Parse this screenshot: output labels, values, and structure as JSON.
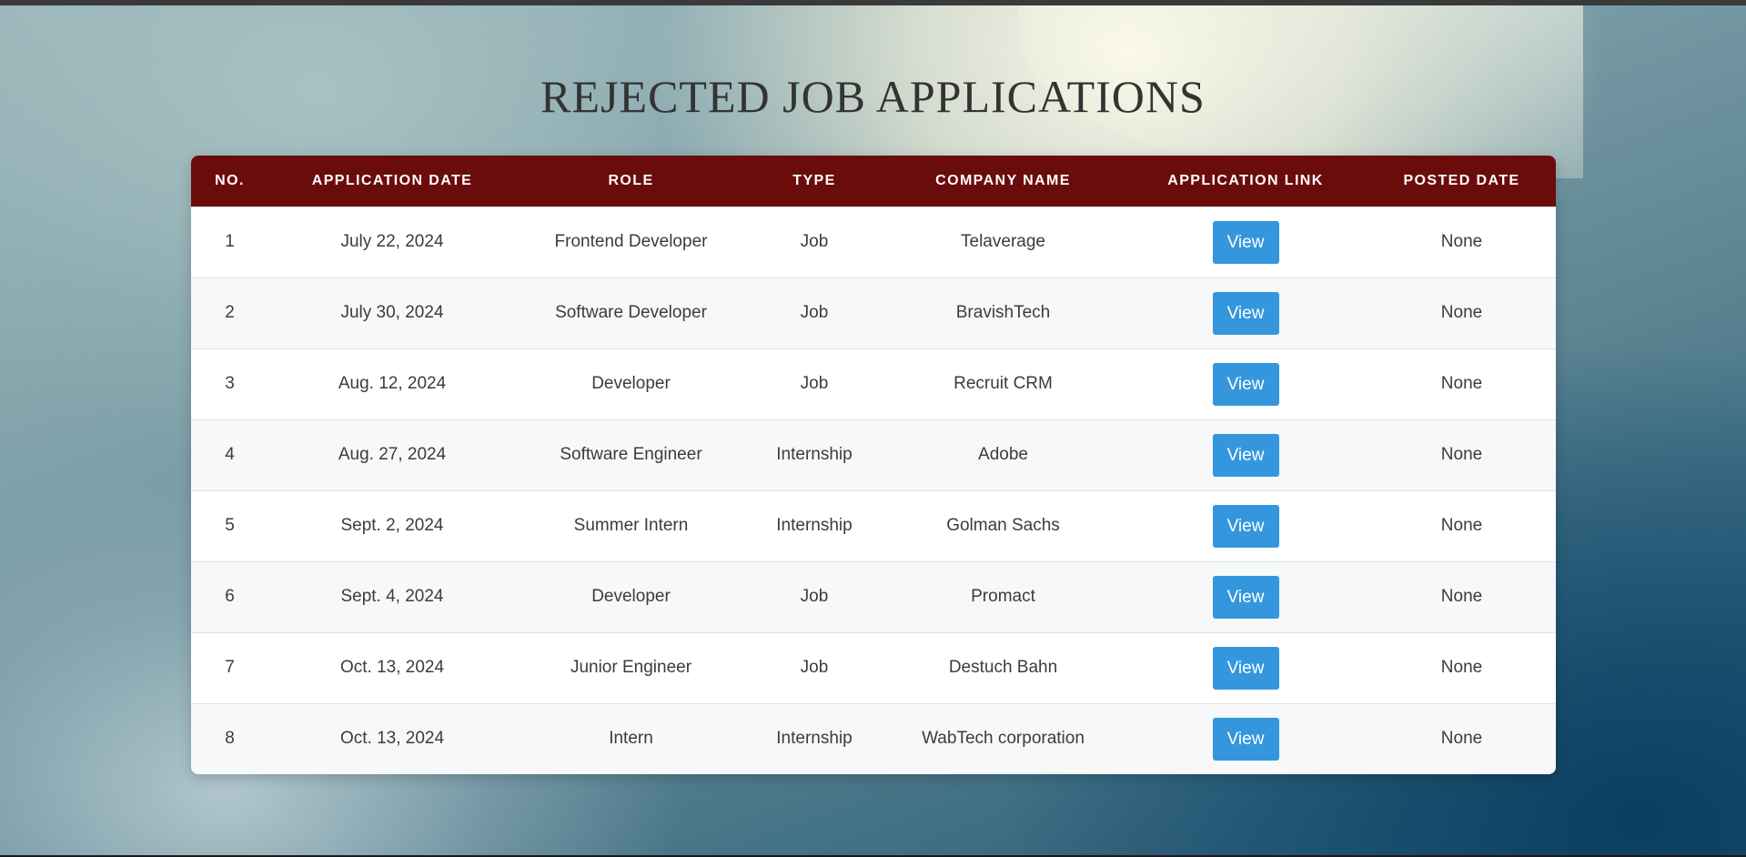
{
  "page": {
    "title": "REJECTED JOB APPLICATIONS"
  },
  "table": {
    "headers": [
      "NO.",
      "APPLICATION DATE",
      "ROLE",
      "TYPE",
      "COMPANY NAME",
      "APPLICATION LINK",
      "POSTED DATE"
    ],
    "rows": [
      {
        "no": "1",
        "date": "July 22, 2024",
        "role": "Frontend Developer",
        "type": "Job",
        "company": "Telaverage",
        "link": "View",
        "posted": "None"
      },
      {
        "no": "2",
        "date": "July 30, 2024",
        "role": "Software Developer",
        "type": "Job",
        "company": "BravishTech",
        "link": "View",
        "posted": "None"
      },
      {
        "no": "3",
        "date": "Aug. 12, 2024",
        "role": "Developer",
        "type": "Job",
        "company": "Recruit CRM",
        "link": "View",
        "posted": "None"
      },
      {
        "no": "4",
        "date": "Aug. 27, 2024",
        "role": "Software Engineer",
        "type": "Internship",
        "company": "Adobe",
        "link": "View",
        "posted": "None"
      },
      {
        "no": "5",
        "date": "Sept. 2, 2024",
        "role": "Summer Intern",
        "type": "Internship",
        "company": "Golman Sachs",
        "link": "View",
        "posted": "None"
      },
      {
        "no": "6",
        "date": "Sept. 4, 2024",
        "role": "Developer",
        "type": "Job",
        "company": "Promact",
        "link": "View",
        "posted": "None"
      },
      {
        "no": "7",
        "date": "Oct. 13, 2024",
        "role": "Junior Engineer",
        "type": "Job",
        "company": "Destuch Bahn",
        "link": "View",
        "posted": "None"
      },
      {
        "no": "8",
        "date": "Oct. 13, 2024",
        "role": "Intern",
        "type": "Internship",
        "company": "WabTech corporation",
        "link": "View",
        "posted": "None"
      }
    ]
  },
  "colors": {
    "header_bg": "#6b0c0c",
    "button_bg": "#3497de",
    "title_text": "#333333"
  }
}
